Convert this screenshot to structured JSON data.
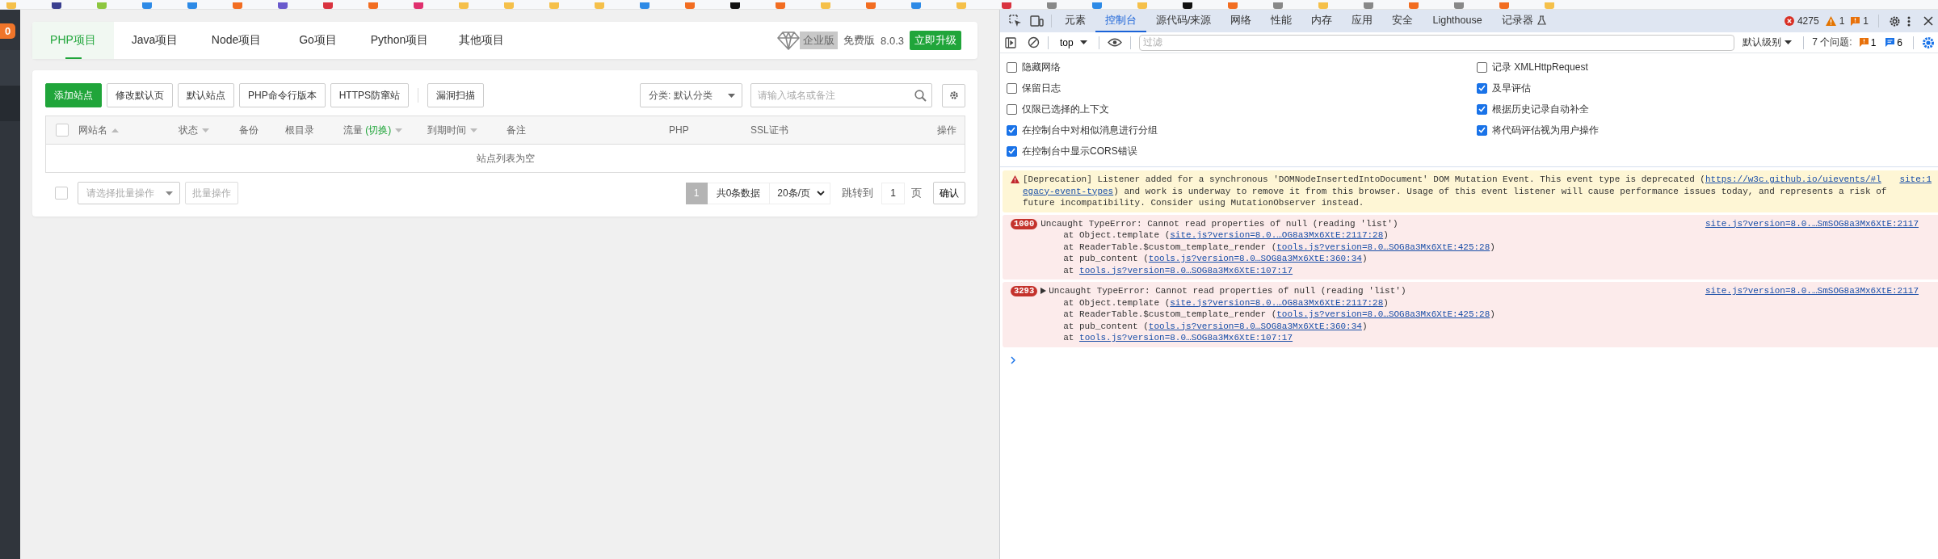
{
  "sidebar": {
    "badge": "0"
  },
  "project_tabs": [
    {
      "label": "PHP项目",
      "selected": true
    },
    {
      "label": "Java项目",
      "selected": false
    },
    {
      "label": "Node项目",
      "selected": false
    },
    {
      "label": "Go项目",
      "selected": false
    },
    {
      "label": "Python项目",
      "selected": false
    },
    {
      "label": "其他项目",
      "selected": false
    }
  ],
  "edition": {
    "enterprise_label": "企业版",
    "free_label": "免费版",
    "version": "8.0.3",
    "upgrade_button": "立即升级"
  },
  "toolbar": {
    "buttons": [
      {
        "label": "添加站点",
        "kind": "primary"
      },
      {
        "label": "修改默认页",
        "kind": "default"
      },
      {
        "label": "默认站点",
        "kind": "default"
      },
      {
        "label": "PHP命令行版本",
        "kind": "default"
      },
      {
        "label": "HTTPS防窜站",
        "kind": "default"
      }
    ],
    "scan_button": "漏洞扫描",
    "category_select": "分类: 默认分类",
    "search_placeholder": "请输入域名或备注"
  },
  "table": {
    "select_all_checked": false,
    "columns": [
      {
        "label": "网站名",
        "sortable": true,
        "ascending": true
      },
      {
        "label": "状态",
        "sortable": true,
        "ascending": false
      },
      {
        "label": "备份",
        "sortable": false
      },
      {
        "label": "根目录",
        "sortable": false
      },
      {
        "label": "流量",
        "note": "(切换)",
        "sortable": true,
        "ascending": false
      },
      {
        "label": "到期时间",
        "sortable": true,
        "ascending": false
      },
      {
        "label": "备注",
        "sortable": false
      },
      {
        "label": "PHP",
        "sortable": false
      },
      {
        "label": "SSL证书",
        "sortable": false
      },
      {
        "label": "操作",
        "sortable": false
      }
    ],
    "empty_text": "站点列表为空"
  },
  "batch": {
    "checked": false,
    "select_placeholder": "请选择批量操作",
    "button": "批量操作"
  },
  "pagination": {
    "current_page": "1",
    "total": "共0条数据",
    "page_size": "20条/页",
    "jump_label": "跳转到",
    "jump_value": "1",
    "page_unit": "页",
    "confirm": "确认"
  },
  "devtools": {
    "tabs": [
      {
        "label": "元素",
        "selected": false,
        "experimental": false
      },
      {
        "label": "控制台",
        "selected": true,
        "experimental": false
      },
      {
        "label": "源代码/来源",
        "selected": false,
        "experimental": false
      },
      {
        "label": "网络",
        "selected": false,
        "experimental": false
      },
      {
        "label": "性能",
        "selected": false,
        "experimental": false
      },
      {
        "label": "内存",
        "selected": false,
        "experimental": false
      },
      {
        "label": "应用",
        "selected": false,
        "experimental": false
      },
      {
        "label": "安全",
        "selected": false,
        "experimental": false
      },
      {
        "label": "Lighthouse",
        "selected": false,
        "experimental": false
      },
      {
        "label": "记录器",
        "selected": false,
        "experimental": true
      }
    ],
    "counters": {
      "errors": "4275",
      "warnings": "1",
      "issues": "1"
    },
    "console_toolbar": {
      "context": "top",
      "filter_placeholder": "过滤",
      "level": "默认级别",
      "issues_label": "7 个问题:",
      "issue_counts": [
        {
          "kind": "warning",
          "count": "1"
        },
        {
          "kind": "info",
          "count": "6"
        }
      ]
    },
    "settings_left": [
      {
        "label": "隐藏网络",
        "checked": false
      },
      {
        "label": "保留日志",
        "checked": false
      },
      {
        "label": "仅限已选择的上下文",
        "checked": false
      },
      {
        "label": "在控制台中对相似消息进行分组",
        "checked": true
      },
      {
        "label": "在控制台中显示CORS错误",
        "checked": true
      }
    ],
    "settings_right": [
      {
        "label": "记录 XMLHttpRequest",
        "checked": false
      },
      {
        "label": "及早评估",
        "checked": true
      },
      {
        "label": "根据历史记录自动补全",
        "checked": true
      },
      {
        "label": "将代码评估视为用户操作",
        "checked": true
      }
    ],
    "messages": [
      {
        "kind": "warning",
        "source": "site:1",
        "lines": [
          [
            {
              "text": "[Deprecation] Listener added for a synchronous 'DOMNodeInsertedIntoDocument' DOM Mutation Event. This event type is deprecated (",
              "link": false
            },
            {
              "text": "https://w3c.github.io/uievents/#l",
              "link": true
            }
          ],
          [
            {
              "text": "egacy-event-types",
              "link": true
            },
            {
              "text": ") and work is underway to remove it from this browser. Usage of this event listener will cause performance issues today, and represents a risk of",
              "link": false
            }
          ],
          [
            {
              "text": "future incompatibility. Consider using MutationObserver instead.",
              "link": false
            }
          ]
        ]
      },
      {
        "kind": "error",
        "count": "1000",
        "expandable": false,
        "source": "site.js?version=8.0.…SmSOG8a3Mx6XtE:2117",
        "title": "Uncaught TypeError: Cannot read properties of null (reading 'list')",
        "frames": [
          [
            {
              "text": "at Object.template (",
              "link": false
            },
            {
              "text": "site.js?version=8.0.…OG8a3Mx6XtE:2117:28",
              "link": true
            },
            {
              "text": ")",
              "link": false
            }
          ],
          [
            {
              "text": "at ReaderTable.$custom_template_render (",
              "link": false
            },
            {
              "text": "tools.js?version=8.0…SOG8a3Mx6XtE:425:28",
              "link": true
            },
            {
              "text": ")",
              "link": false
            }
          ],
          [
            {
              "text": "at pub_content (",
              "link": false
            },
            {
              "text": "tools.js?version=8.0…SOG8a3Mx6XtE:360:34",
              "link": true
            },
            {
              "text": ")",
              "link": false
            }
          ],
          [
            {
              "text": "at ",
              "link": false
            },
            {
              "text": "tools.js?version=8.0…SOG8a3Mx6XtE:107:17",
              "link": true
            }
          ]
        ]
      },
      {
        "kind": "error",
        "count": "3293",
        "expandable": true,
        "source": "site.js?version=8.0.…SmSOG8a3Mx6XtE:2117",
        "title": "Uncaught TypeError: Cannot read properties of null (reading 'list')",
        "frames": [
          [
            {
              "text": "at Object.template (",
              "link": false
            },
            {
              "text": "site.js?version=8.0.…OG8a3Mx6XtE:2117:28",
              "link": true
            },
            {
              "text": ")",
              "link": false
            }
          ],
          [
            {
              "text": "at ReaderTable.$custom_template_render (",
              "link": false
            },
            {
              "text": "tools.js?version=8.0…SOG8a3Mx6XtE:425:28",
              "link": true
            },
            {
              "text": ")",
              "link": false
            }
          ],
          [
            {
              "text": "at pub_content (",
              "link": false
            },
            {
              "text": "tools.js?version=8.0…SOG8a3Mx6XtE:360:34",
              "link": true
            },
            {
              "text": ")",
              "link": false
            }
          ],
          [
            {
              "text": "at ",
              "link": false
            },
            {
              "text": "tools.js?version=8.0…SOG8a3Mx6XtE:107:17",
              "link": true
            }
          ]
        ]
      }
    ]
  }
}
